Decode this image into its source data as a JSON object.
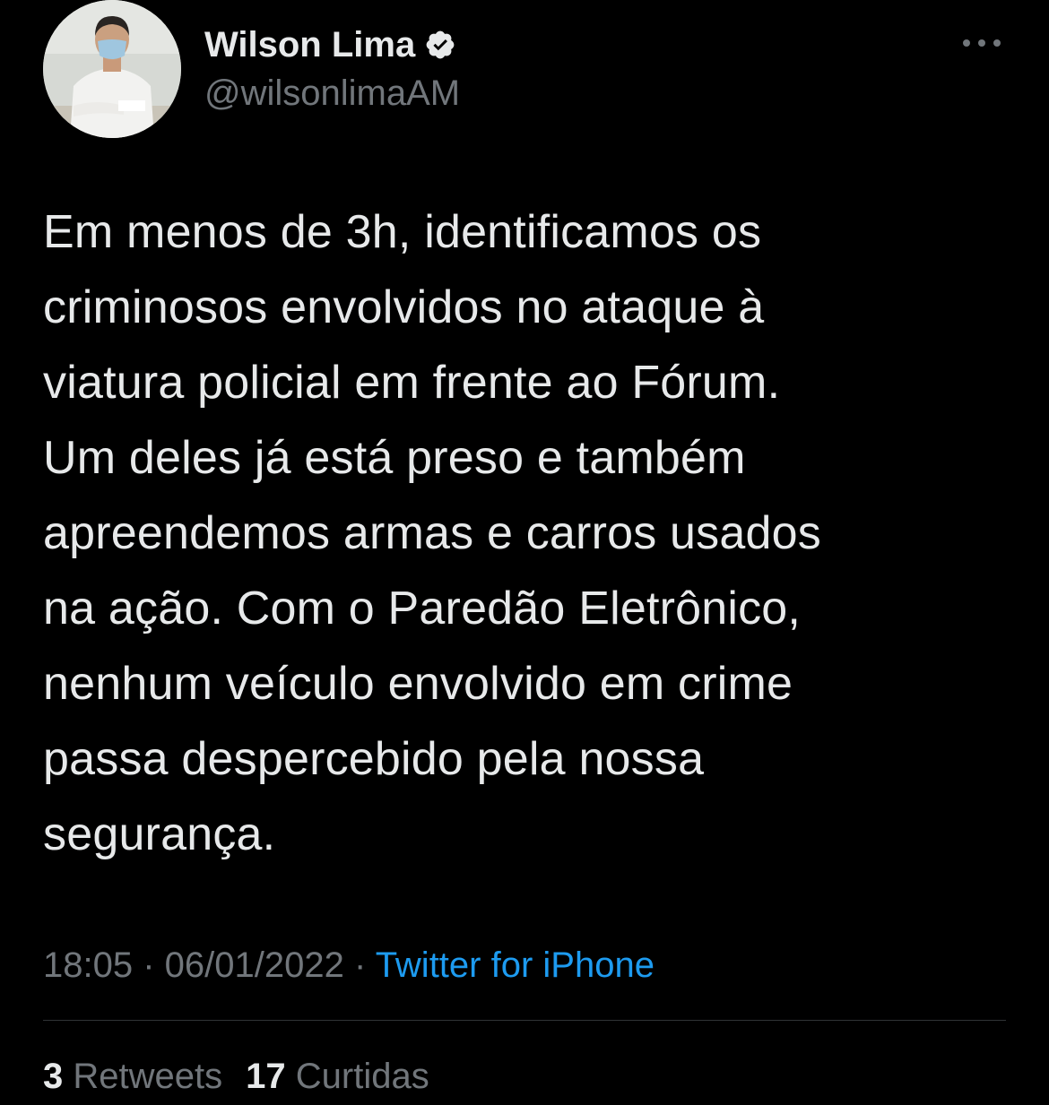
{
  "author": {
    "display_name": "Wilson Lima",
    "handle": "@wilsonlimaAM",
    "verified_icon": "verified-badge-icon"
  },
  "more_icon": "more-horizontal-icon",
  "tweet": {
    "text": "Em menos de 3h, identificamos os\ncriminosos envolvidos no ataque à\nviatura policial em frente ao Fórum.\nUm deles já está preso e também\napreendemos armas e carros usados\nna ação. Com o Paredão Eletrônico,\nnenhum veículo envolvido em crime\npassa despercebido pela nossa\nsegurança."
  },
  "meta": {
    "time": "18:05",
    "separator": " · ",
    "date": "06/01/2022",
    "source": "Twitter for iPhone"
  },
  "stats": {
    "retweets_count": "3",
    "retweets_label": "Retweets",
    "likes_count": "17",
    "likes_label": "Curtidas"
  },
  "colors": {
    "background": "#000000",
    "text": "#e7e9ea",
    "secondary": "#71767b",
    "link": "#1d9bf0",
    "divider": "#2f3336"
  }
}
